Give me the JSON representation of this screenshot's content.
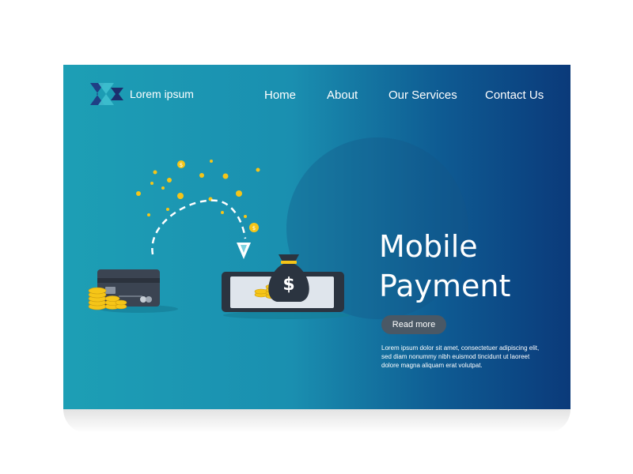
{
  "brand": {
    "name": "Lorem ipsum",
    "logo_icon": "double-chevron-logo-icon"
  },
  "nav": {
    "items": [
      "Home",
      "About",
      "Our Services",
      "Contact Us"
    ]
  },
  "hero": {
    "title_line1": "Mobile",
    "title_line2": "Payment",
    "button_label": "Read more",
    "description": "Lorem ipsum dolor sit amet, consectetuer adipiscing elit, sed diam nonummy nibh euismod tincidunt ut laoreet dolore magna aliquam erat volutpat."
  },
  "illustration": {
    "coin_symbol": "$",
    "bag_symbol": "$",
    "icons": [
      "credit-card-icon",
      "coin-stack-icon",
      "money-bag-icon",
      "tablet-icon",
      "arrow-down-icon",
      "coin-icon"
    ]
  },
  "colors": {
    "background_start": "#1d9fb5",
    "background_end": "#0b3a7a",
    "button": "#4a5865",
    "coin": "#f5c518",
    "text": "#ffffff"
  }
}
